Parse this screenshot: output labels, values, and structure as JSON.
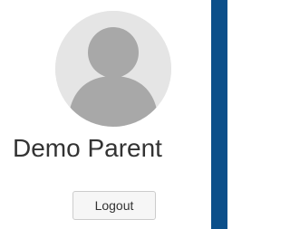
{
  "profile": {
    "name": "Demo Parent",
    "avatar_icon": "user-silhouette-icon"
  },
  "actions": {
    "logout_label": "Logout"
  },
  "colors": {
    "avatar_background": "#e5e5e5",
    "avatar_silhouette": "#a8a8a8",
    "side_strip": "#0b4f8a",
    "text": "#333333",
    "button_background": "#f6f6f6",
    "button_border": "#cccccc"
  }
}
